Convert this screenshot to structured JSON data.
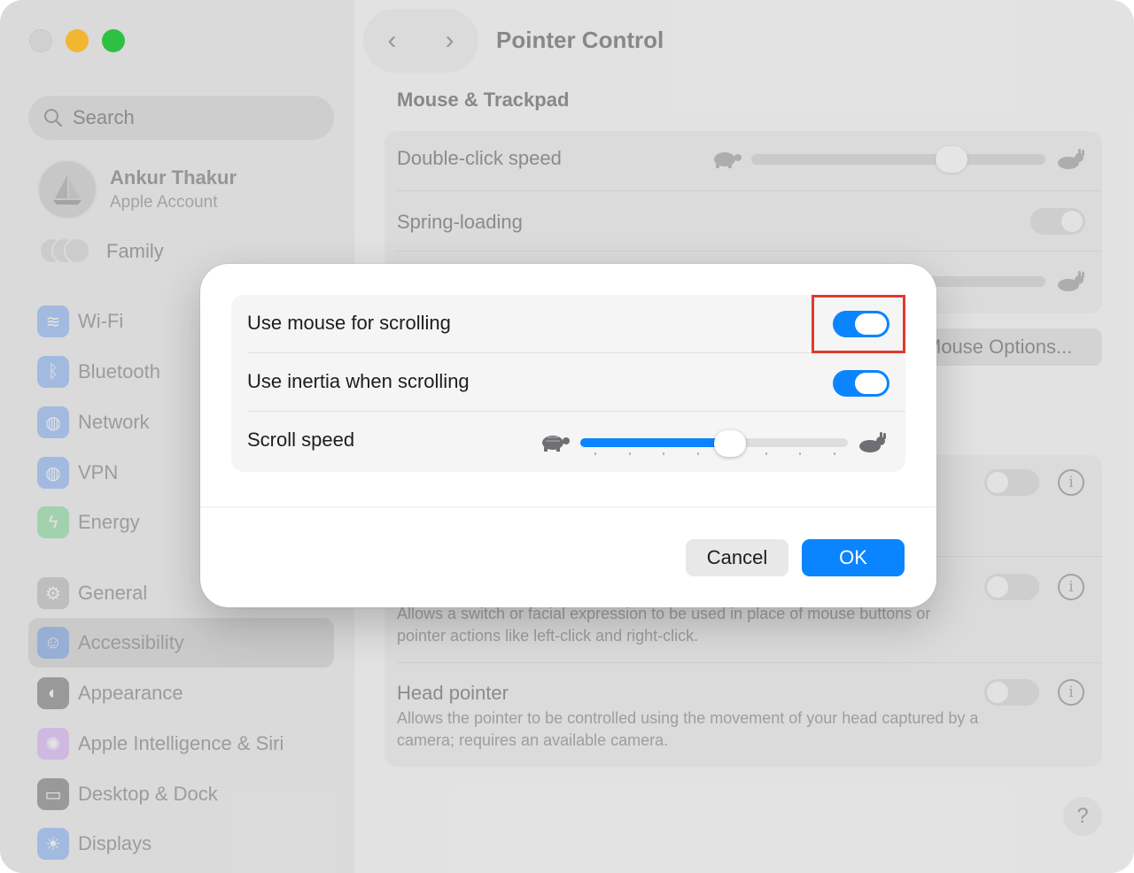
{
  "sidebar": {
    "search_placeholder": "Search",
    "account": {
      "name": "Ankur Thakur",
      "subtitle": "Apple Account"
    },
    "family_label": "Family",
    "items": [
      {
        "label": "Wi-Fi",
        "icon": "wifi-icon",
        "color": "#3b82f6"
      },
      {
        "label": "Bluetooth",
        "icon": "bluetooth-icon",
        "color": "#3b82f6"
      },
      {
        "label": "Network",
        "icon": "globe-icon",
        "color": "#3b82f6"
      },
      {
        "label": "VPN",
        "icon": "vpn-globe-icon",
        "color": "#3b82f6"
      },
      {
        "label": "Energy",
        "icon": "energy-icon",
        "color": "#34c759"
      },
      {
        "label": "General",
        "icon": "gear-icon",
        "color": "#8e8e93"
      },
      {
        "label": "Accessibility",
        "icon": "accessibility-icon",
        "color": "#3b82f6",
        "selected": true
      },
      {
        "label": "Appearance",
        "icon": "appearance-icon",
        "color": "#1c1c1e"
      },
      {
        "label": "Apple Intelligence & Siri",
        "icon": "siri-icon",
        "color": "#c084fc"
      },
      {
        "label": "Desktop & Dock",
        "icon": "dock-icon",
        "color": "#1c1c1e"
      },
      {
        "label": "Displays",
        "icon": "display-icon",
        "color": "#3b82f6"
      }
    ]
  },
  "header": {
    "back": "‹",
    "forward": "›",
    "title": "Pointer Control"
  },
  "main": {
    "section_title": "Mouse & Trackpad",
    "double_click_label": "Double-click speed",
    "spring_loading_label": "Spring-loading",
    "mouse_options_button": "Mouse Options...",
    "switch_desc": "Allows a switch or facial expression to be used in place of mouse buttons or pointer actions like left-click and right-click.",
    "head_pointer_label": "Head pointer",
    "head_pointer_desc": "Allows the pointer to be controlled using the movement of your head captured by a camera; requires an available camera.",
    "info_glyph": "i",
    "help_glyph": "?"
  },
  "dialog": {
    "use_mouse_scrolling_label": "Use mouse for scrolling",
    "use_mouse_scrolling_on": true,
    "use_inertia_label": "Use inertia when scrolling",
    "use_inertia_on": true,
    "scroll_speed_label": "Scroll speed",
    "scroll_speed_fraction": 0.56,
    "cancel_label": "Cancel",
    "ok_label": "OK",
    "accent_color": "#0a84ff",
    "highlight_color": "#e03a2f"
  }
}
